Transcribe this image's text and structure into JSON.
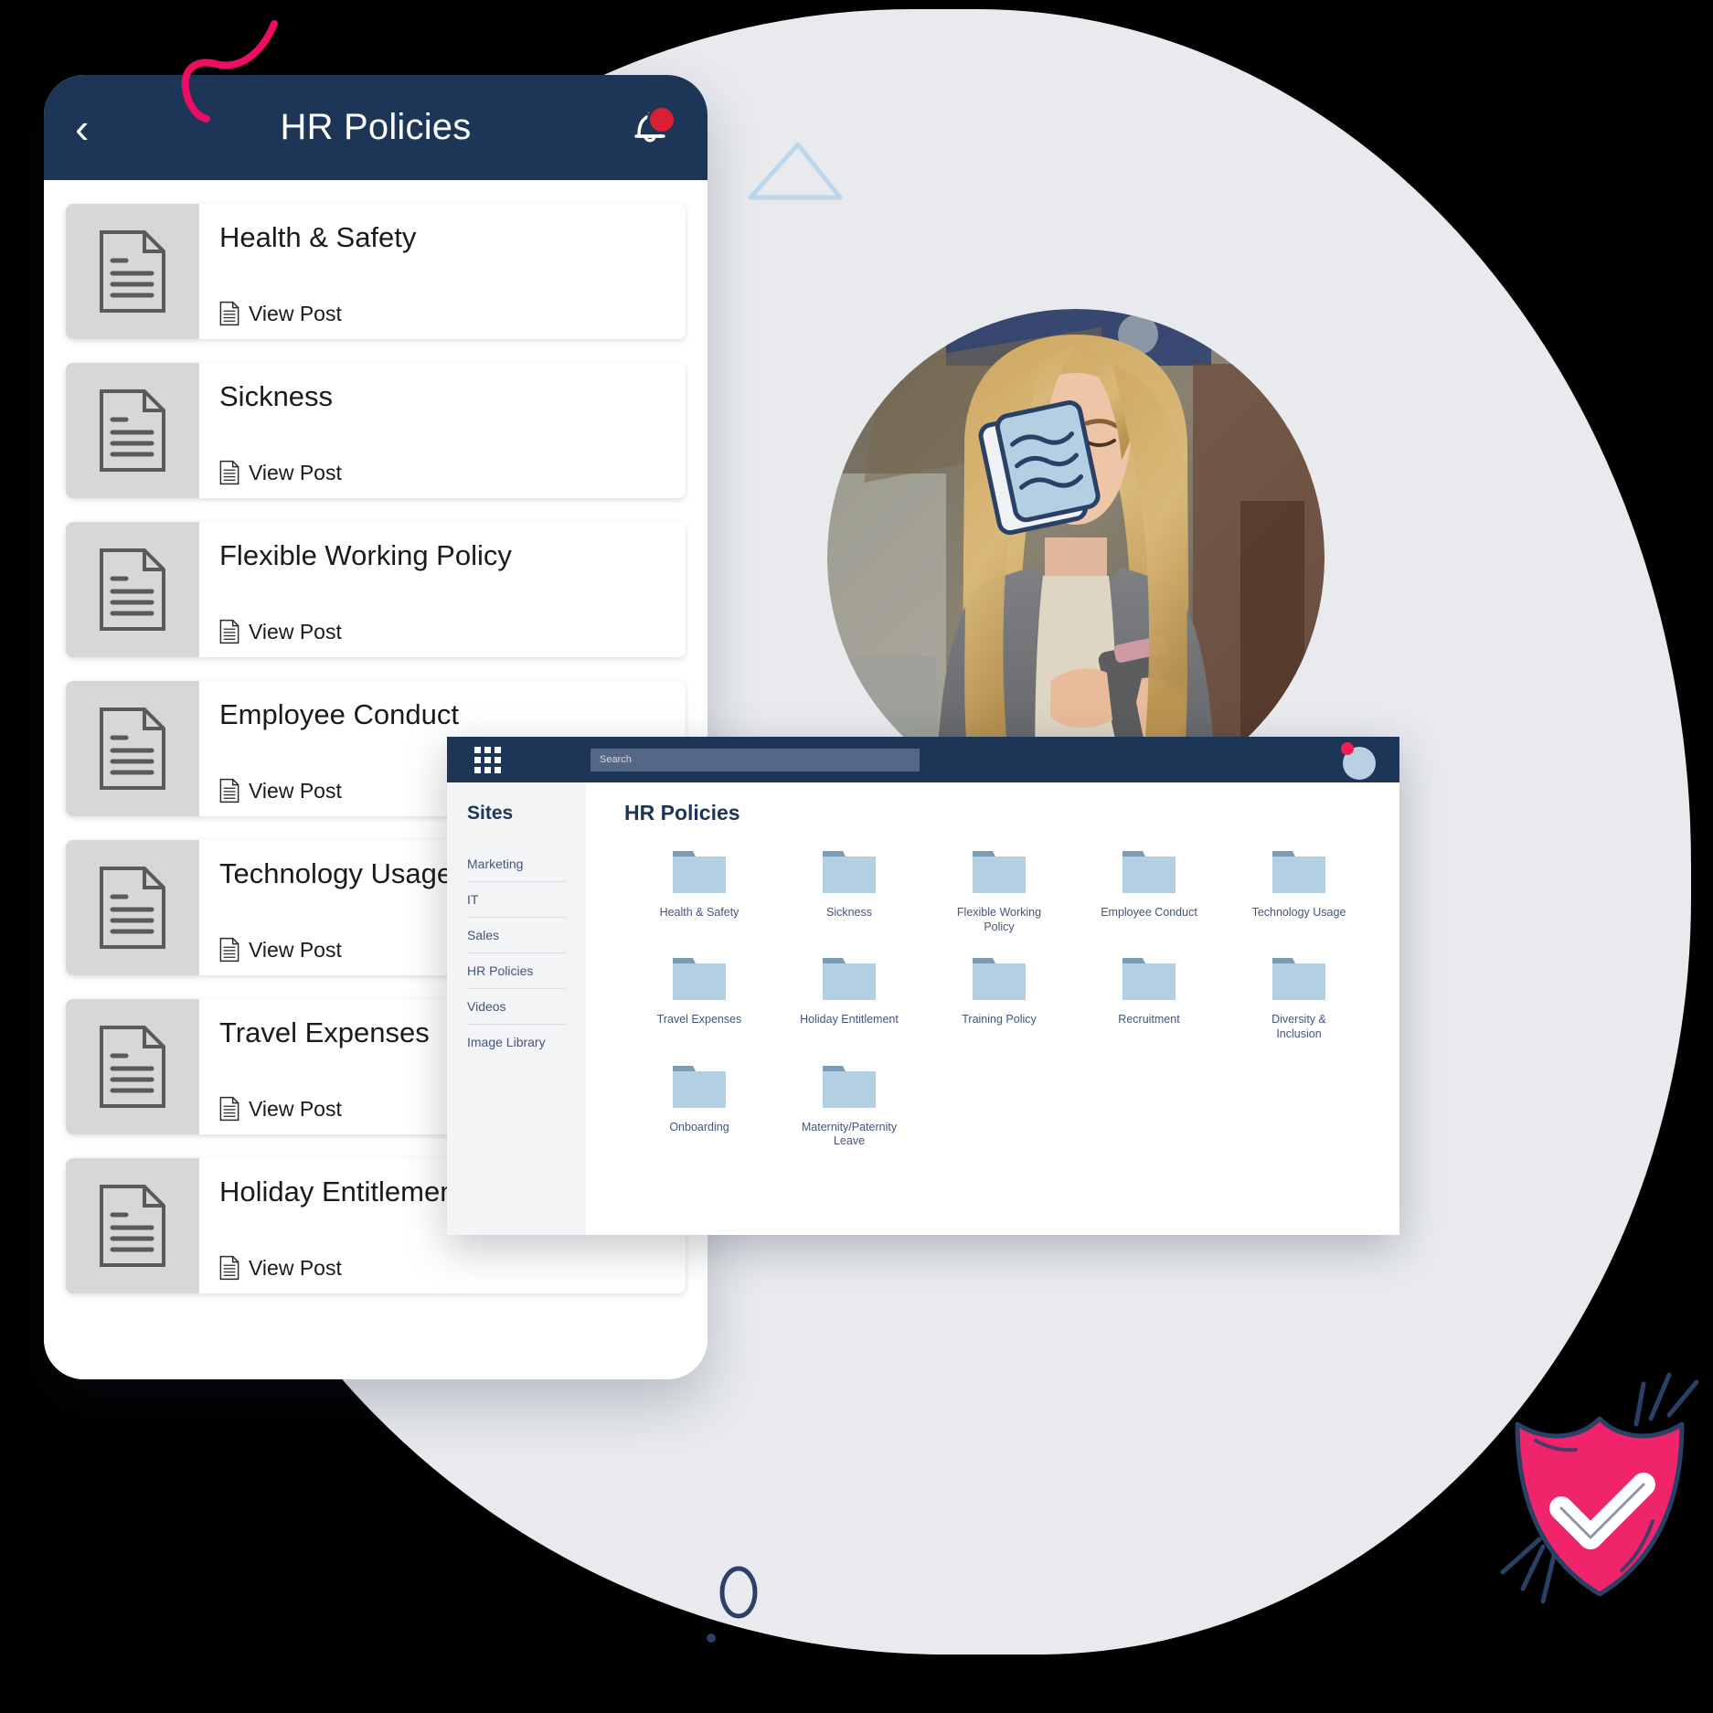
{
  "theme": {
    "navy": "#1d3557",
    "pink": "#f01d52",
    "folder_blue": "#b3cfe2",
    "folder_tab": "#7c9bb5",
    "bg": "#e8eaee",
    "card_gray": "#d7d7d7"
  },
  "phone": {
    "title": "HR Policies",
    "back_icon": "chevron-left-icon",
    "bell_icon": "notification-bell-icon",
    "view_post_label": "View Post",
    "items": [
      {
        "title": "Health & Safety"
      },
      {
        "title": "Sickness"
      },
      {
        "title": "Flexible Working Policy"
      },
      {
        "title": "Employee Conduct"
      },
      {
        "title": "Technology Usage"
      },
      {
        "title": "Travel Expenses"
      },
      {
        "title": "Holiday Entitlement"
      }
    ]
  },
  "desktop": {
    "waffle_icon": "app-grid-icon",
    "search": {
      "placeholder": "Search",
      "value": ""
    },
    "avatar_icon": "user-avatar-icon",
    "sidebar": {
      "title": "Sites",
      "items": [
        {
          "label": "Marketing"
        },
        {
          "label": "IT"
        },
        {
          "label": "Sales"
        },
        {
          "label": "HR Policies"
        },
        {
          "label": "Videos"
        },
        {
          "label": "Image Library"
        }
      ]
    },
    "content": {
      "title": "HR Policies",
      "folders": [
        {
          "label": "Health & Safety"
        },
        {
          "label": "Sickness"
        },
        {
          "label": "Flexible Working Policy"
        },
        {
          "label": "Employee Conduct"
        },
        {
          "label": "Technology Usage"
        },
        {
          "label": "Travel Expenses"
        },
        {
          "label": "Holiday Entitlement"
        },
        {
          "label": "Training Policy"
        },
        {
          "label": "Recruitment"
        },
        {
          "label": "Diversity & Inclusion"
        },
        {
          "label": "Onboarding"
        },
        {
          "label": "Maternity/Paternity Leave"
        }
      ]
    }
  },
  "decorations": {
    "squiggle": "pink-squiggle-icon",
    "triangle": "outline-triangle-icon",
    "book": "tilted-document-icon",
    "shield": "shield-check-icon",
    "circle_doodle": "small-circle-doodle-icon",
    "photo": "woman-using-phone-photo"
  }
}
